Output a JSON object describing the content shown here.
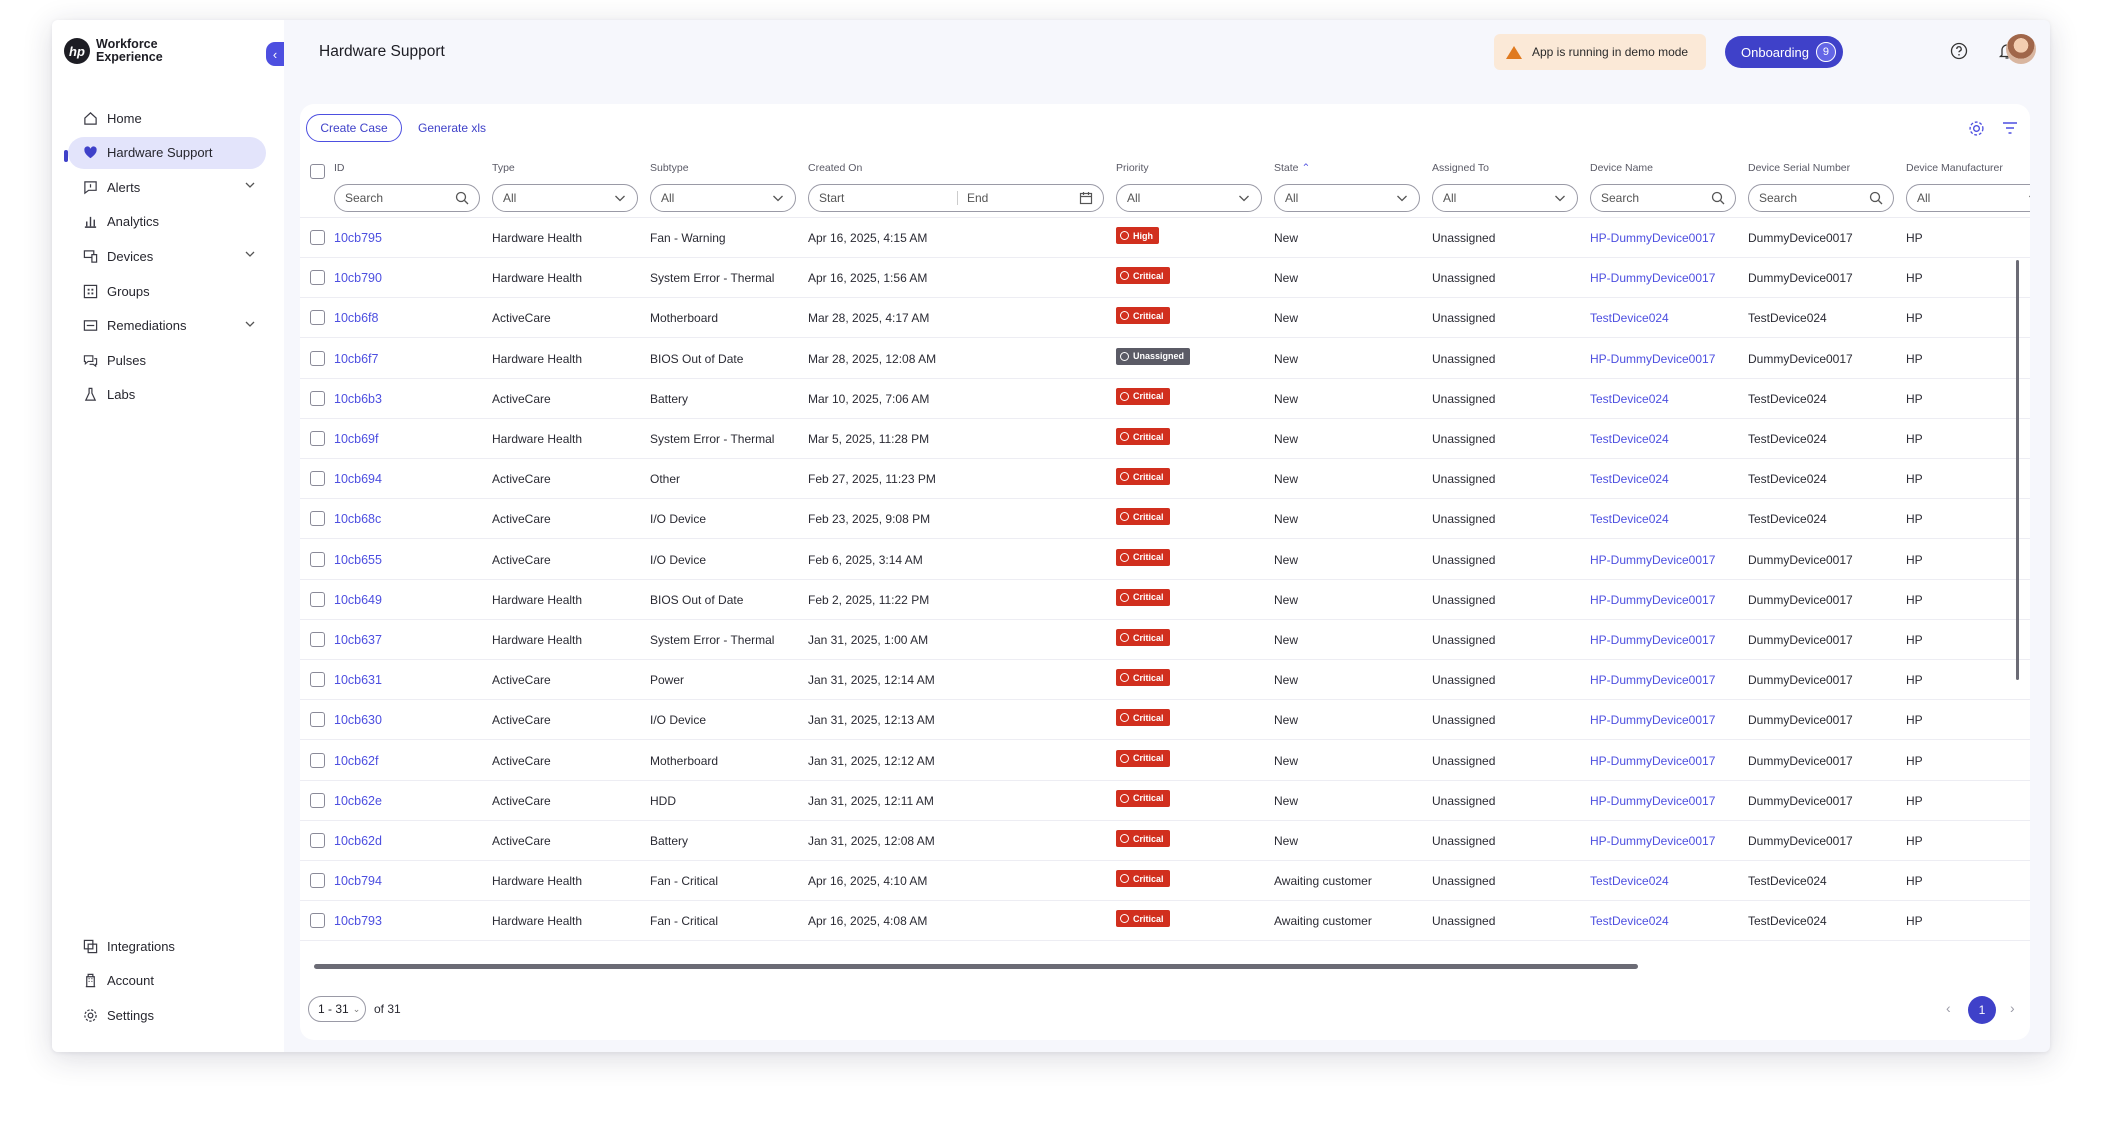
{
  "brand": {
    "logo_text_1": "Workforce",
    "logo_text_2": "Experience",
    "logo_mark": "hp"
  },
  "sidebar": {
    "items": [
      {
        "label": "Home",
        "icon": "home-icon"
      },
      {
        "label": "Hardware Support",
        "icon": "heart-icon",
        "active": true
      },
      {
        "label": "Alerts",
        "icon": "alert-icon",
        "expandable": true
      },
      {
        "label": "Analytics",
        "icon": "bar-chart-icon"
      },
      {
        "label": "Devices",
        "icon": "devices-icon",
        "expandable": true
      },
      {
        "label": "Groups",
        "icon": "groups-icon"
      },
      {
        "label": "Remediations",
        "icon": "remediations-icon",
        "expandable": true
      },
      {
        "label": "Pulses",
        "icon": "pulses-icon"
      },
      {
        "label": "Labs",
        "icon": "flask-icon"
      }
    ],
    "bottom_items": [
      {
        "label": "Integrations",
        "icon": "integrations-icon"
      },
      {
        "label": "Account",
        "icon": "account-icon"
      },
      {
        "label": "Settings",
        "icon": "gear-icon"
      }
    ]
  },
  "header": {
    "title": "Hardware Support",
    "demo_text": "App is running in demo mode",
    "onboarding_label": "Onboarding",
    "onboarding_count": "9"
  },
  "toolbar": {
    "create_label": "Create Case",
    "generate_label": "Generate xls"
  },
  "columns": [
    "ID",
    "Type",
    "Subtype",
    "Created On",
    "Priority",
    "State",
    "Assigned To",
    "Device Name",
    "Device Serial Number",
    "Device Manufacturer"
  ],
  "filters": {
    "search_placeholder": "Search",
    "all_label": "All",
    "start_label": "Start",
    "end_label": "End"
  },
  "rows": [
    {
      "id": "10cb795",
      "type": "Hardware Health",
      "subtype": "Fan - Warning",
      "created": "Apr 16, 2025, 4:15 AM",
      "priority": "High",
      "priority_level": "high",
      "state": "New",
      "assigned": "Unassigned",
      "device": "HP-DummyDevice0017",
      "serial": "DummyDevice0017",
      "mfr": "HP"
    },
    {
      "id": "10cb790",
      "type": "Hardware Health",
      "subtype": "System Error - Thermal",
      "created": "Apr 16, 2025, 1:56 AM",
      "priority": "Critical",
      "priority_level": "critical",
      "state": "New",
      "assigned": "Unassigned",
      "device": "HP-DummyDevice0017",
      "serial": "DummyDevice0017",
      "mfr": "HP"
    },
    {
      "id": "10cb6f8",
      "type": "ActiveCare",
      "subtype": "Motherboard",
      "created": "Mar 28, 2025, 4:17 AM",
      "priority": "Critical",
      "priority_level": "critical",
      "state": "New",
      "assigned": "Unassigned",
      "device": "TestDevice024",
      "serial": "TestDevice024",
      "mfr": "HP"
    },
    {
      "id": "10cb6f7",
      "type": "Hardware Health",
      "subtype": "BIOS Out of Date",
      "created": "Mar 28, 2025, 12:08 AM",
      "priority": "Unassigned",
      "priority_level": "unassigned",
      "state": "New",
      "assigned": "Unassigned",
      "device": "HP-DummyDevice0017",
      "serial": "DummyDevice0017",
      "mfr": "HP"
    },
    {
      "id": "10cb6b3",
      "type": "ActiveCare",
      "subtype": "Battery",
      "created": "Mar 10, 2025, 7:06 AM",
      "priority": "Critical",
      "priority_level": "critical",
      "state": "New",
      "assigned": "Unassigned",
      "device": "TestDevice024",
      "serial": "TestDevice024",
      "mfr": "HP"
    },
    {
      "id": "10cb69f",
      "type": "Hardware Health",
      "subtype": "System Error - Thermal",
      "created": "Mar 5, 2025, 11:28 PM",
      "priority": "Critical",
      "priority_level": "critical",
      "state": "New",
      "assigned": "Unassigned",
      "device": "TestDevice024",
      "serial": "TestDevice024",
      "mfr": "HP"
    },
    {
      "id": "10cb694",
      "type": "ActiveCare",
      "subtype": "Other",
      "created": "Feb 27, 2025, 11:23 PM",
      "priority": "Critical",
      "priority_level": "critical",
      "state": "New",
      "assigned": "Unassigned",
      "device": "TestDevice024",
      "serial": "TestDevice024",
      "mfr": "HP"
    },
    {
      "id": "10cb68c",
      "type": "ActiveCare",
      "subtype": "I/O Device",
      "created": "Feb 23, 2025, 9:08 PM",
      "priority": "Critical",
      "priority_level": "critical",
      "state": "New",
      "assigned": "Unassigned",
      "device": "TestDevice024",
      "serial": "TestDevice024",
      "mfr": "HP"
    },
    {
      "id": "10cb655",
      "type": "ActiveCare",
      "subtype": "I/O Device",
      "created": "Feb 6, 2025, 3:14 AM",
      "priority": "Critical",
      "priority_level": "critical",
      "state": "New",
      "assigned": "Unassigned",
      "device": "HP-DummyDevice0017",
      "serial": "DummyDevice0017",
      "mfr": "HP"
    },
    {
      "id": "10cb649",
      "type": "Hardware Health",
      "subtype": "BIOS Out of Date",
      "created": "Feb 2, 2025, 11:22 PM",
      "priority": "Critical",
      "priority_level": "critical",
      "state": "New",
      "assigned": "Unassigned",
      "device": "HP-DummyDevice0017",
      "serial": "DummyDevice0017",
      "mfr": "HP"
    },
    {
      "id": "10cb637",
      "type": "Hardware Health",
      "subtype": "System Error - Thermal",
      "created": "Jan 31, 2025, 1:00 AM",
      "priority": "Critical",
      "priority_level": "critical",
      "state": "New",
      "assigned": "Unassigned",
      "device": "HP-DummyDevice0017",
      "serial": "DummyDevice0017",
      "mfr": "HP"
    },
    {
      "id": "10cb631",
      "type": "ActiveCare",
      "subtype": "Power",
      "created": "Jan 31, 2025, 12:14 AM",
      "priority": "Critical",
      "priority_level": "critical",
      "state": "New",
      "assigned": "Unassigned",
      "device": "HP-DummyDevice0017",
      "serial": "DummyDevice0017",
      "mfr": "HP"
    },
    {
      "id": "10cb630",
      "type": "ActiveCare",
      "subtype": "I/O Device",
      "created": "Jan 31, 2025, 12:13 AM",
      "priority": "Critical",
      "priority_level": "critical",
      "state": "New",
      "assigned": "Unassigned",
      "device": "HP-DummyDevice0017",
      "serial": "DummyDevice0017",
      "mfr": "HP"
    },
    {
      "id": "10cb62f",
      "type": "ActiveCare",
      "subtype": "Motherboard",
      "created": "Jan 31, 2025, 12:12 AM",
      "priority": "Critical",
      "priority_level": "critical",
      "state": "New",
      "assigned": "Unassigned",
      "device": "HP-DummyDevice0017",
      "serial": "DummyDevice0017",
      "mfr": "HP"
    },
    {
      "id": "10cb62e",
      "type": "ActiveCare",
      "subtype": "HDD",
      "created": "Jan 31, 2025, 12:11 AM",
      "priority": "Critical",
      "priority_level": "critical",
      "state": "New",
      "assigned": "Unassigned",
      "device": "HP-DummyDevice0017",
      "serial": "DummyDevice0017",
      "mfr": "HP"
    },
    {
      "id": "10cb62d",
      "type": "ActiveCare",
      "subtype": "Battery",
      "created": "Jan 31, 2025, 12:08 AM",
      "priority": "Critical",
      "priority_level": "critical",
      "state": "New",
      "assigned": "Unassigned",
      "device": "HP-DummyDevice0017",
      "serial": "DummyDevice0017",
      "mfr": "HP"
    },
    {
      "id": "10cb794",
      "type": "Hardware Health",
      "subtype": "Fan - Critical",
      "created": "Apr 16, 2025, 4:10 AM",
      "priority": "Critical",
      "priority_level": "critical",
      "state": "Awaiting customer",
      "assigned": "Unassigned",
      "device": "TestDevice024",
      "serial": "TestDevice024",
      "mfr": "HP"
    },
    {
      "id": "10cb793",
      "type": "Hardware Health",
      "subtype": "Fan - Critical",
      "created": "Apr 16, 2025, 4:08 AM",
      "priority": "Critical",
      "priority_level": "critical",
      "state": "Awaiting customer",
      "assigned": "Unassigned",
      "device": "TestDevice024",
      "serial": "TestDevice024",
      "mfr": "HP"
    }
  ],
  "pagination": {
    "range": "1 - 31",
    "of_label": "of 31",
    "current_page": "1"
  },
  "colors": {
    "accent": "#3f41c9",
    "critical": "#d12f1e",
    "unassigned": "#5b5b66",
    "demo_bg": "#fbe9d7"
  }
}
